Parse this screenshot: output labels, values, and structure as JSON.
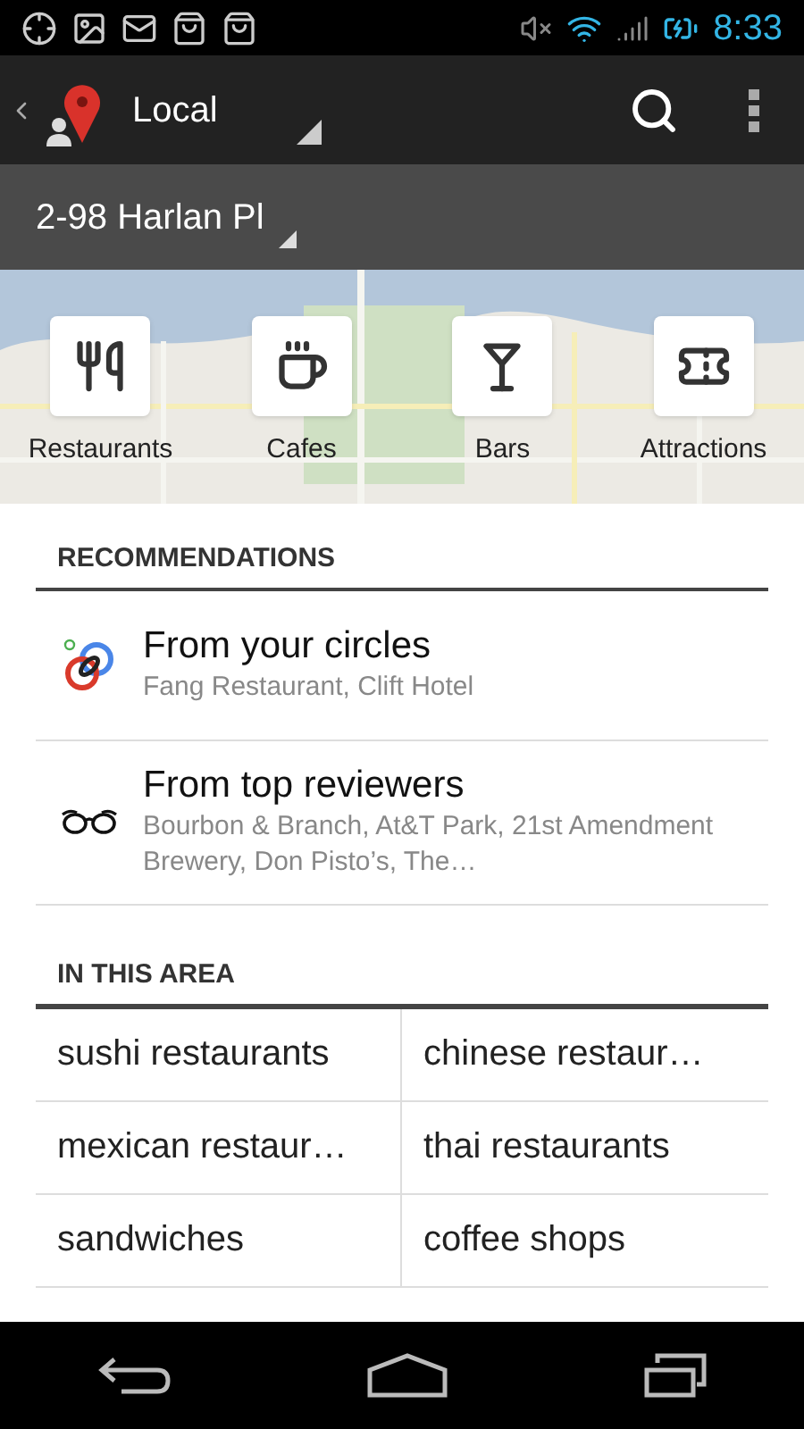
{
  "status_bar": {
    "time": "8:33"
  },
  "action_bar": {
    "title": "Local"
  },
  "location": {
    "address": "2-98 Harlan Pl"
  },
  "categories": [
    {
      "label": "Restaurants",
      "kind": "restaurant"
    },
    {
      "label": "Cafes",
      "kind": "cafe"
    },
    {
      "label": "Bars",
      "kind": "bar"
    },
    {
      "label": "Attractions",
      "kind": "attraction"
    }
  ],
  "recommendations": {
    "heading": "RECOMMENDATIONS",
    "items": [
      {
        "kind": "circles",
        "title": "From your circles",
        "subtitle": "Fang Restaurant, Clift Hotel"
      },
      {
        "kind": "reviewers",
        "title": "From top reviewers",
        "subtitle": "Bourbon & Branch, At&T Park, 21st Amendment Brewery, Don Pisto’s, The…"
      }
    ]
  },
  "area": {
    "heading": "IN THIS AREA",
    "cells": [
      "sushi restaurants",
      "chinese restaur…",
      "mexican restaur…",
      "thai restaurants",
      "sandwiches",
      "coffee shops"
    ]
  }
}
